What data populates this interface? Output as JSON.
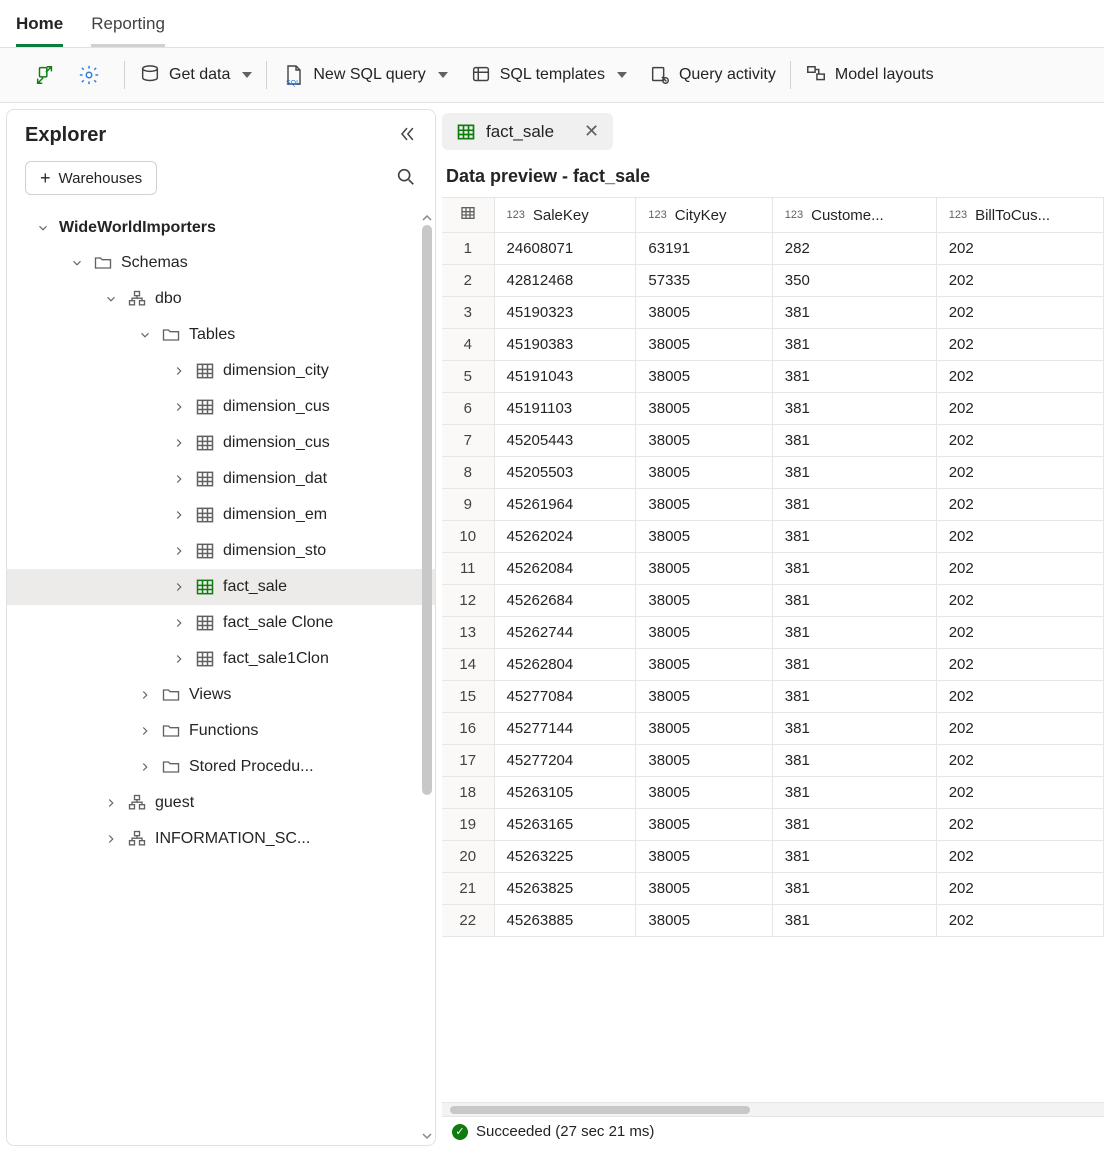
{
  "tabs": {
    "home": "Home",
    "reporting": "Reporting"
  },
  "toolbar": {
    "getData": "Get data",
    "newSql": "New SQL query",
    "sqlTemplates": "SQL templates",
    "queryActivity": "Query activity",
    "modelLayouts": "Model layouts"
  },
  "explorer": {
    "title": "Explorer",
    "warehousesBtn": "Warehouses",
    "tree": {
      "db": "WideWorldImporters",
      "schemas": "Schemas",
      "dbo": "dbo",
      "tablesLabel": "Tables",
      "tables": [
        "dimension_city",
        "dimension_cus",
        "dimension_cus",
        "dimension_dat",
        "dimension_em",
        "dimension_sto",
        "fact_sale",
        "fact_sale Clone",
        "fact_sale1Clon"
      ],
      "views": "Views",
      "functions": "Functions",
      "storedProc": "Stored Procedu...",
      "guest": "guest",
      "infoSchema": "INFORMATION_SC..."
    }
  },
  "objectTab": "fact_sale",
  "previewTitle": "Data preview - fact_sale",
  "columns": [
    {
      "name": "SaleKey",
      "type": "123"
    },
    {
      "name": "CityKey",
      "type": "123"
    },
    {
      "name": "Custome...",
      "type": "123"
    },
    {
      "name": "BillToCus...",
      "type": "123"
    }
  ],
  "rows": [
    [
      "24608071",
      "63191",
      "282",
      "202"
    ],
    [
      "42812468",
      "57335",
      "350",
      "202"
    ],
    [
      "45190323",
      "38005",
      "381",
      "202"
    ],
    [
      "45190383",
      "38005",
      "381",
      "202"
    ],
    [
      "45191043",
      "38005",
      "381",
      "202"
    ],
    [
      "45191103",
      "38005",
      "381",
      "202"
    ],
    [
      "45205443",
      "38005",
      "381",
      "202"
    ],
    [
      "45205503",
      "38005",
      "381",
      "202"
    ],
    [
      "45261964",
      "38005",
      "381",
      "202"
    ],
    [
      "45262024",
      "38005",
      "381",
      "202"
    ],
    [
      "45262084",
      "38005",
      "381",
      "202"
    ],
    [
      "45262684",
      "38005",
      "381",
      "202"
    ],
    [
      "45262744",
      "38005",
      "381",
      "202"
    ],
    [
      "45262804",
      "38005",
      "381",
      "202"
    ],
    [
      "45277084",
      "38005",
      "381",
      "202"
    ],
    [
      "45277144",
      "38005",
      "381",
      "202"
    ],
    [
      "45277204",
      "38005",
      "381",
      "202"
    ],
    [
      "45263105",
      "38005",
      "381",
      "202"
    ],
    [
      "45263165",
      "38005",
      "381",
      "202"
    ],
    [
      "45263225",
      "38005",
      "381",
      "202"
    ],
    [
      "45263825",
      "38005",
      "381",
      "202"
    ],
    [
      "45263885",
      "38005",
      "381",
      "202"
    ]
  ],
  "status": "Succeeded (27 sec 21 ms)"
}
